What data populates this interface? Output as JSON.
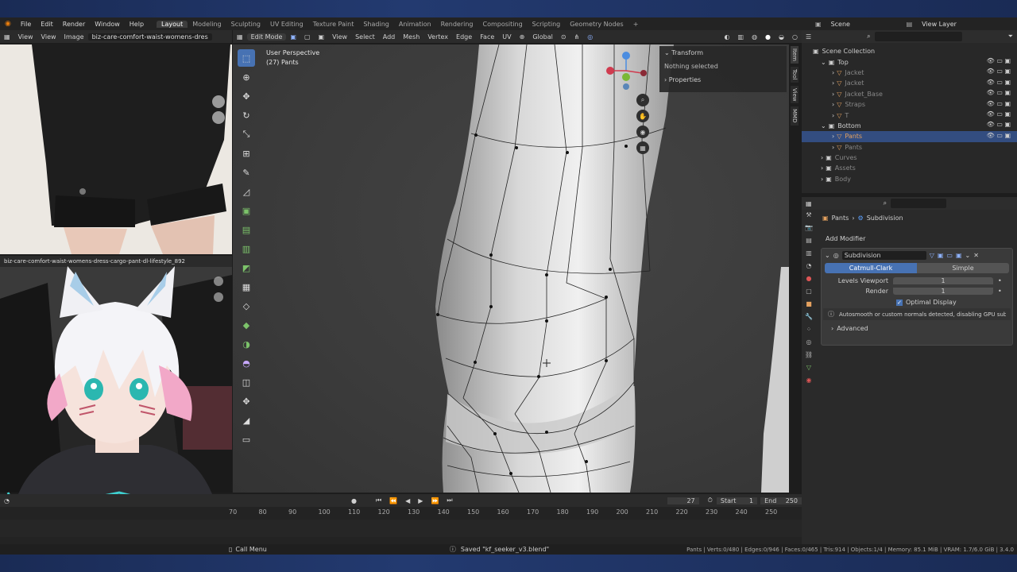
{
  "app": {
    "menus": [
      "File",
      "Edit",
      "Render",
      "Window",
      "Help"
    ],
    "workspaces": [
      "Layout",
      "Modeling",
      "Sculpting",
      "UV Editing",
      "Texture Paint",
      "Shading",
      "Animation",
      "Rendering",
      "Compositing",
      "Scripting",
      "Geometry Nodes"
    ],
    "active_workspace": "Layout",
    "scene": "Scene",
    "view_layer": "View Layer"
  },
  "image_editor": {
    "menus": [
      "View",
      "View",
      "Image"
    ],
    "image_name": "biz-care-comfort-waist-womens-dres",
    "second_image_name": "biz-care-comfort-waist-womens-dress-cargo-pant-dl-lifestyle_892"
  },
  "viewport": {
    "mode": "Edit Mode",
    "menus": [
      "View",
      "Select",
      "Add",
      "Mesh",
      "Vertex",
      "Edge",
      "Face",
      "UV"
    ],
    "orientation": "Global",
    "perspective_label": "User Perspective",
    "object_label": "(27) Pants",
    "side_tabs": [
      "Item",
      "Tool",
      "View",
      "MMD"
    ],
    "npanel": {
      "transform": "Transform",
      "nothing_selected": "Nothing selected",
      "properties": "Properties"
    }
  },
  "outliner": {
    "title": "Scene Collection",
    "items": [
      {
        "label": "Top",
        "depth": 1
      },
      {
        "label": "Jacket",
        "depth": 2
      },
      {
        "label": "Jacket",
        "depth": 2
      },
      {
        "label": "Jacket_Base",
        "depth": 2
      },
      {
        "label": "Straps",
        "depth": 2
      },
      {
        "label": "T",
        "depth": 2
      },
      {
        "label": "Bottom",
        "depth": 1
      },
      {
        "label": "Pants",
        "depth": 2,
        "selected": true
      },
      {
        "label": "Pants",
        "depth": 2
      },
      {
        "label": "Curves",
        "depth": 1
      },
      {
        "label": "Assets",
        "depth": 1
      },
      {
        "label": "Body",
        "depth": 1
      }
    ]
  },
  "properties": {
    "breadcrumb_object": "Pants",
    "breadcrumb_modifier": "Subdivision",
    "add_modifier": "Add Modifier",
    "modifier_name": "Subdivision",
    "method_catmull": "Catmull-Clark",
    "method_simple": "Simple",
    "levels_viewport_label": "Levels Viewport",
    "levels_viewport": "1",
    "render_label": "Render",
    "render_value": "1",
    "optimal_display": "Optimal Display",
    "warning": "Autosmooth or custom normals detected, disabling GPU subdi...",
    "advanced": "Advanced"
  },
  "timeline": {
    "current_frame": "27",
    "start_label": "Start",
    "start": "1",
    "end_label": "End",
    "end": "250",
    "ticks": [
      "70",
      "80",
      "90",
      "100",
      "110",
      "120",
      "130",
      "140",
      "150",
      "160",
      "170",
      "180",
      "190",
      "200",
      "210",
      "220",
      "230",
      "240",
      "250"
    ]
  },
  "status": {
    "call_menu": "Call Menu",
    "saved": "Saved \"kf_seeker_v3.blend\"",
    "stats": "Pants | Verts:0/480 | Edges:0/946 | Faces:0/465 | Tris:914 | Objects:1/4 | Memory: 85.1 MiB | VRAM: 1.7/6.0 GiB | 3.4.0"
  },
  "colors": {
    "accent": "#4772b3",
    "selected_row": "#334d80",
    "warning": "#e0e0e0",
    "mesh_icon": "#e4a15f",
    "modifier_icon": "#5aa0ff"
  }
}
